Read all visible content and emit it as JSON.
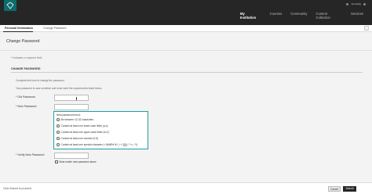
{
  "topbar": {
    "user_label": "Joe Eddy",
    "nav": [
      "My Institution",
      "Courses",
      "Community",
      "Content Collection",
      "Services"
    ]
  },
  "subnav": {
    "tabs": [
      "Personal Information",
      "Change Password"
    ]
  },
  "page": {
    "title": "Change Password",
    "required_note": "Indicates a required field.",
    "required_star": "*",
    "section_title": "CHANGE PASSWORD",
    "instructions": [
      "Complete this form to change the password.",
      "Your password is case sensitive and must meet the requirements listed below."
    ]
  },
  "form": {
    "old_password_label": "Old Password",
    "new_password_label": "New Password",
    "verify_label": "Verify New Password",
    "match_text": "Must match new password above",
    "rules_heading": "New password must:",
    "rules": [
      "Be between 12-32 characters",
      "Contain at least one lower-case letter (a-z)",
      "Contain at least one upper-case letter (A-Z)",
      "Contain at least one number (0-9)",
      "Contain at least one special character (~!@#$%^&*_+=`\\[]{}|:;\"'<>,.?/)"
    ]
  },
  "footer": {
    "hint": "Click Submit to proceed.",
    "cancel_label": "Cancel",
    "submit_label": "Submit"
  },
  "colors": {
    "topbar": "#262626",
    "accent": "#1da0a5",
    "logo": "#0c6b6b"
  }
}
